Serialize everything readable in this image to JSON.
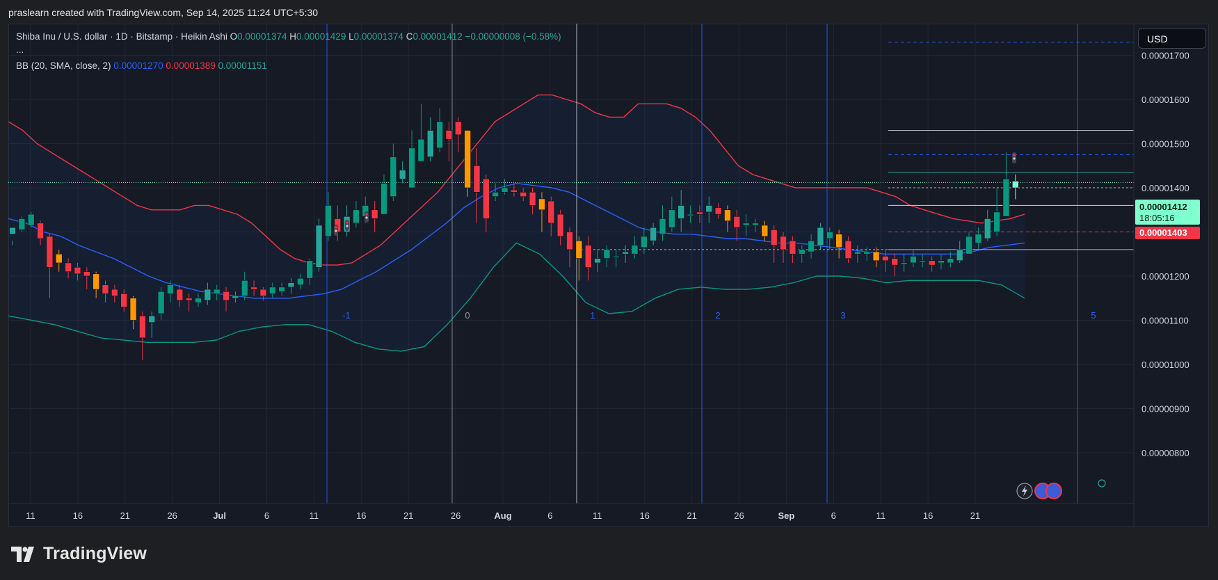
{
  "header": {
    "attribution": "praslearn created with TradingView.com, Sep 14, 2025 11:24 UTC+5:30"
  },
  "legend": {
    "symbol": "Shiba Inu / U.S. dollar · 1D · Bitstamp · Heikin Ashi",
    "o_label": "O",
    "o_value": "0.00001374",
    "h_label": "H",
    "h_value": "0.00001429",
    "l_label": "L",
    "l_value": "0.00001374",
    "c_label": "C",
    "c_value": "0.00001412",
    "change": "−0.00000008 (−0.58%)",
    "more": "...",
    "bb_label": "BB (20, SMA, close, 2)",
    "bb_basis": "0.00001270",
    "bb_upper": "0.00001389",
    "bb_lower": "0.00001151"
  },
  "currency_button": "USD",
  "price_labels": {
    "last_price": "0.00001412",
    "countdown": "18:05:16",
    "prev_close": "0.00001403"
  },
  "colors": {
    "bull_candle": "#089981",
    "bull_candle_bright": "#26a69a",
    "bear_candle": "#f23645",
    "bear_candle_bright": "#ff9800",
    "bb_upper": "#f23645",
    "bb_basis": "#2962ff",
    "bb_lower": "#089981",
    "background": "#161a25",
    "last_price_tag": "#80ffcf",
    "prev_close_tag": "#f23645"
  },
  "brand": {
    "logo_text": "TradingView"
  },
  "icons": {
    "lightning": "lightning-icon",
    "flags": "us-flag-icons",
    "dark_mode": "sun-moon-icon"
  },
  "cycle_labels": [
    "-1",
    "0",
    "1",
    "2",
    "3",
    "5"
  ],
  "chart_data": {
    "type": "candlestick",
    "title": "Shiba Inu / U.S. dollar · 1D · Bitstamp · Heikin Ashi",
    "x_ticks": [
      "11",
      "16",
      "21",
      "26",
      "Jul",
      "6",
      "11",
      "16",
      "21",
      "26",
      "Aug",
      "6",
      "11",
      "16",
      "21",
      "26",
      "Sep",
      "6",
      "11",
      "16",
      "21"
    ],
    "y_ticks": [
      "0.00001700",
      "0.00001600",
      "0.00001500",
      "0.00001400",
      "0.00001300",
      "0.00001200",
      "0.00001100",
      "0.00001000",
      "0.00000900",
      "0.00000800"
    ],
    "ylim": [
      7.5e-06,
      1.81e-05
    ],
    "candles": [
      [
        12.95,
        13.1,
        12.8,
        12.7
      ],
      [
        13.05,
        13.3,
        13.35,
        13.0
      ],
      [
        13.15,
        13.4,
        13.45,
        13.1
      ],
      [
        13.2,
        12.85,
        13.25,
        12.7
      ],
      [
        12.9,
        12.2,
        12.95,
        11.5
      ],
      [
        12.5,
        12.3,
        12.6,
        12.1
      ],
      [
        12.3,
        12.1,
        12.4,
        11.95
      ],
      [
        12.2,
        12.05,
        12.3,
        11.9
      ],
      [
        12.1,
        12.0,
        12.2,
        11.7
      ],
      [
        12.05,
        11.7,
        12.1,
        11.5
      ],
      [
        11.8,
        11.6,
        11.9,
        11.4
      ],
      [
        11.7,
        11.55,
        11.8,
        11.4
      ],
      [
        11.6,
        11.3,
        11.7,
        11.2
      ],
      [
        11.5,
        11.0,
        11.55,
        10.8
      ],
      [
        11.1,
        10.6,
        11.2,
        10.1
      ],
      [
        10.95,
        11.1,
        11.2,
        10.6
      ],
      [
        11.15,
        11.65,
        11.75,
        11.0
      ],
      [
        11.6,
        11.8,
        11.9,
        11.4
      ],
      [
        11.7,
        11.45,
        11.8,
        11.3
      ],
      [
        11.5,
        11.45,
        11.6,
        11.2
      ],
      [
        11.4,
        11.5,
        11.6,
        11.3
      ],
      [
        11.45,
        11.7,
        11.85,
        11.35
      ],
      [
        11.6,
        11.7,
        11.8,
        11.45
      ],
      [
        11.65,
        11.45,
        11.75,
        11.2
      ],
      [
        11.5,
        11.55,
        11.65,
        11.4
      ],
      [
        11.55,
        11.9,
        12.1,
        11.45
      ],
      [
        11.75,
        11.7,
        11.9,
        11.55
      ],
      [
        11.7,
        11.55,
        11.75,
        11.45
      ],
      [
        11.6,
        11.75,
        11.85,
        11.5
      ],
      [
        11.65,
        11.75,
        11.85,
        11.55
      ],
      [
        11.75,
        11.85,
        11.95,
        11.6
      ],
      [
        11.8,
        11.95,
        12.05,
        11.7
      ],
      [
        11.95,
        12.35,
        12.4,
        11.8
      ],
      [
        12.2,
        13.15,
        13.3,
        12.1
      ],
      [
        12.9,
        13.6,
        13.9,
        12.8
      ],
      [
        13.3,
        13.0,
        13.6,
        12.8
      ],
      [
        13.0,
        13.35,
        13.6,
        12.9
      ],
      [
        13.2,
        13.5,
        13.7,
        13.1
      ],
      [
        13.35,
        13.6,
        13.8,
        13.2
      ],
      [
        13.5,
        13.3,
        13.7,
        13.0
      ],
      [
        13.4,
        14.1,
        14.3,
        13.4
      ],
      [
        13.8,
        14.7,
        15.0,
        13.7
      ],
      [
        14.2,
        14.4,
        14.6,
        14.1
      ],
      [
        14.0,
        14.9,
        15.3,
        14.0
      ],
      [
        14.6,
        15.1,
        15.9,
        14.6
      ],
      [
        14.7,
        15.3,
        15.6,
        14.6
      ],
      [
        14.9,
        15.5,
        15.8,
        14.8
      ],
      [
        15.3,
        15.1,
        15.5,
        14.6
      ],
      [
        15.5,
        15.2,
        15.6,
        14.8
      ],
      [
        15.3,
        14.0,
        15.3,
        13.8
      ],
      [
        14.5,
        13.9,
        14.9,
        13.2
      ],
      [
        14.2,
        13.3,
        14.3,
        13.0
      ],
      [
        13.8,
        13.9,
        14.1,
        13.7
      ],
      [
        13.9,
        14.0,
        14.2,
        13.85
      ],
      [
        13.95,
        13.9,
        14.1,
        13.8
      ],
      [
        13.9,
        13.8,
        14.0,
        13.7
      ],
      [
        13.9,
        13.6,
        14.0,
        13.4
      ],
      [
        13.75,
        13.5,
        13.9,
        13.0
      ],
      [
        13.7,
        13.2,
        13.8,
        12.9
      ],
      [
        13.4,
        12.9,
        13.5,
        12.7
      ],
      [
        13.0,
        12.6,
        13.1,
        12.2
      ],
      [
        12.8,
        12.4,
        12.9,
        11.9
      ],
      [
        12.7,
        12.2,
        12.9,
        11.9
      ],
      [
        12.3,
        12.4,
        12.6,
        12.1
      ],
      [
        12.4,
        12.6,
        12.7,
        12.2
      ],
      [
        12.45,
        12.45,
        12.6,
        12.2
      ],
      [
        12.5,
        12.55,
        12.7,
        12.3
      ],
      [
        12.5,
        12.7,
        12.9,
        12.4
      ],
      [
        12.65,
        12.9,
        13.1,
        12.5
      ],
      [
        12.8,
        13.1,
        13.2,
        12.7
      ],
      [
        12.95,
        13.3,
        13.6,
        12.8
      ],
      [
        13.1,
        13.5,
        13.8,
        13.0
      ],
      [
        13.3,
        13.6,
        13.95,
        13.0
      ],
      [
        13.4,
        13.4,
        13.6,
        13.2
      ],
      [
        13.45,
        13.4,
        13.6,
        13.2
      ],
      [
        13.45,
        13.6,
        13.8,
        13.2
      ],
      [
        13.55,
        13.4,
        13.65,
        13.3
      ],
      [
        13.5,
        13.25,
        13.6,
        13.0
      ],
      [
        13.35,
        13.1,
        13.5,
        12.8
      ],
      [
        13.15,
        13.2,
        13.4,
        12.9
      ],
      [
        13.15,
        13.2,
        13.3,
        13.0
      ],
      [
        13.15,
        12.9,
        13.25,
        12.8
      ],
      [
        13.05,
        12.7,
        13.15,
        12.3
      ],
      [
        12.9,
        12.6,
        13.0,
        12.3
      ],
      [
        12.8,
        12.5,
        12.9,
        12.3
      ],
      [
        12.5,
        12.6,
        12.7,
        12.3
      ],
      [
        12.55,
        12.8,
        12.95,
        12.4
      ],
      [
        12.7,
        13.1,
        13.2,
        12.6
      ],
      [
        12.85,
        13.0,
        13.1,
        12.6
      ],
      [
        12.95,
        12.65,
        13.05,
        12.4
      ],
      [
        12.8,
        12.4,
        12.9,
        12.3
      ],
      [
        12.5,
        12.55,
        12.7,
        12.3
      ],
      [
        12.5,
        12.55,
        12.65,
        12.35
      ],
      [
        12.55,
        12.35,
        12.65,
        12.2
      ],
      [
        12.45,
        12.35,
        12.6,
        12.1
      ],
      [
        12.4,
        12.25,
        12.5,
        12.0
      ],
      [
        12.3,
        12.3,
        12.5,
        12.1
      ],
      [
        12.3,
        12.45,
        12.6,
        12.2
      ],
      [
        12.35,
        12.35,
        12.5,
        12.2
      ],
      [
        12.35,
        12.25,
        12.45,
        12.1
      ],
      [
        12.3,
        12.35,
        12.5,
        12.15
      ],
      [
        12.3,
        12.4,
        12.55,
        12.2
      ],
      [
        12.35,
        12.6,
        12.8,
        12.3
      ],
      [
        12.5,
        12.9,
        13.0,
        12.5
      ],
      [
        12.75,
        12.95,
        13.1,
        12.6
      ],
      [
        12.85,
        13.3,
        13.5,
        12.8
      ],
      [
        13.0,
        13.45,
        14.0,
        12.9
      ],
      [
        13.35,
        14.2,
        14.8,
        13.35
      ],
      [
        14.0,
        14.15,
        14.3,
        13.74
      ]
    ],
    "bb_upper": [
      15.5,
      15.3,
      15.0,
      14.8,
      14.6,
      14.4,
      14.2,
      14.0,
      13.8,
      13.6,
      13.5,
      13.5,
      13.5,
      13.6,
      13.6,
      13.5,
      13.4,
      13.2,
      12.9,
      12.6,
      12.4,
      12.3,
      12.25,
      12.25,
      12.3,
      12.5,
      12.7,
      13.0,
      13.3,
      13.6,
      13.9,
      14.3,
      14.7,
      15.1,
      15.5,
      15.7,
      15.9,
      16.1,
      16.1,
      16.0,
      15.9,
      15.7,
      15.6,
      15.6,
      15.9,
      15.9,
      15.9,
      15.8,
      15.6,
      15.3,
      14.9,
      14.5,
      14.3,
      14.2,
      14.1,
      14.0,
      14.0,
      14.0,
      14.0,
      14.0,
      14.0,
      13.9,
      13.8,
      13.6,
      13.5,
      13.4,
      13.3,
      13.25,
      13.2,
      13.25,
      13.3,
      13.4
    ],
    "bb_basis": [
      13.3,
      13.2,
      13.0,
      12.9,
      12.7,
      12.55,
      12.4,
      12.2,
      12.0,
      11.85,
      11.75,
      11.65,
      11.6,
      11.55,
      11.5,
      11.5,
      11.5,
      11.55,
      11.6,
      11.7,
      11.9,
      12.1,
      12.35,
      12.6,
      12.9,
      13.2,
      13.55,
      13.8,
      14.0,
      14.1,
      14.05,
      14.0,
      13.9,
      13.7,
      13.5,
      13.3,
      13.1,
      13.0,
      12.95,
      12.95,
      12.9,
      12.85,
      12.85,
      12.8,
      12.75,
      12.75,
      12.7,
      12.65,
      12.6,
      12.55,
      12.5,
      12.5,
      12.5,
      12.5,
      12.5,
      12.55,
      12.65,
      12.7,
      12.75
    ],
    "bb_lower": [
      11.1,
      11.0,
      10.9,
      10.75,
      10.6,
      10.55,
      10.5,
      10.5,
      10.5,
      10.55,
      10.75,
      10.85,
      10.9,
      10.9,
      10.75,
      10.5,
      10.35,
      10.3,
      10.4,
      10.9,
      11.5,
      12.2,
      12.75,
      12.5,
      12.0,
      11.4,
      11.15,
      11.2,
      11.5,
      11.7,
      11.75,
      11.7,
      11.7,
      11.75,
      11.85,
      12.0,
      12.0,
      11.95,
      11.85,
      11.9,
      11.9,
      11.9,
      11.9,
      11.8,
      11.5
    ]
  }
}
